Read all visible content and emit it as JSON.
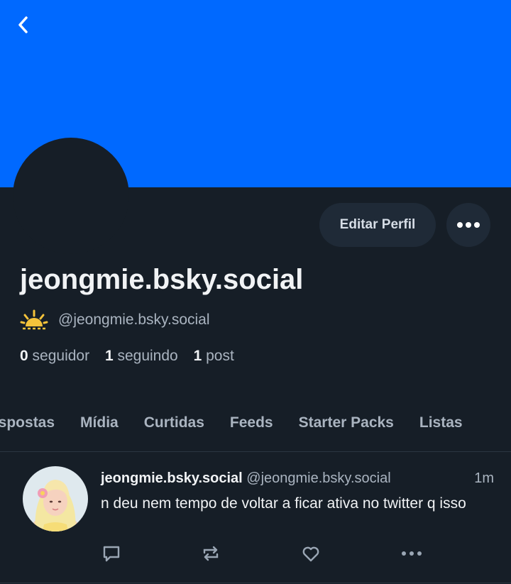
{
  "header": {
    "back_icon": "chevron-left-icon",
    "banner_color": "#0069ff"
  },
  "profile": {
    "edit_label": "Editar Perfil",
    "more_icon": "ellipsis-icon",
    "display_name": "jeongmie.bsky.social",
    "handle_emoji": "sunrise-emoji-icon",
    "handle": "@jeongmie.bsky.social",
    "stats": {
      "followers_count": "0",
      "followers_label": "seguidor",
      "following_count": "1",
      "following_label": "seguindo",
      "posts_count": "1",
      "posts_label": "post"
    }
  },
  "tabs": [
    {
      "label": "espostas"
    },
    {
      "label": "Mídia"
    },
    {
      "label": "Curtidas"
    },
    {
      "label": "Feeds"
    },
    {
      "label": "Starter Packs"
    },
    {
      "label": "Listas"
    }
  ],
  "post": {
    "author": "jeongmie.bsky.social",
    "handle": "@jeongmie.bsky.social",
    "time": "1m",
    "text": "n deu nem tempo de voltar a ficar ativa no twitter q isso",
    "actions": [
      "reply-icon",
      "repost-icon",
      "like-icon",
      "more-icon"
    ]
  },
  "colors": {
    "background": "#161e27",
    "button_bg": "#1f2a37",
    "muted_text": "#aab4c0"
  }
}
